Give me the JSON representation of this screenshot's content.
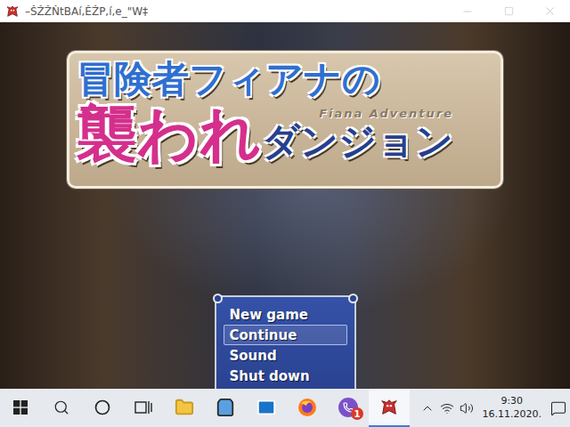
{
  "window": {
    "title": "–ŠŽŽŇtBAí,ĚŽP,í,e_\"W‡"
  },
  "logo": {
    "line1": "冒険者フィアナの",
    "line2_main": "襲われ",
    "line2_rest": "ダンジョン",
    "subtitle": "Fiana Adventure"
  },
  "menu": {
    "items": [
      {
        "label": "New game",
        "selected": false
      },
      {
        "label": "Continue",
        "selected": true
      },
      {
        "label": "Sound",
        "selected": false
      },
      {
        "label": "Shut down",
        "selected": false
      }
    ]
  },
  "taskbar": {
    "apps": [
      {
        "kind": "start",
        "active": false,
        "badge": ""
      },
      {
        "kind": "search",
        "active": false,
        "badge": ""
      },
      {
        "kind": "cortana",
        "active": false,
        "badge": ""
      },
      {
        "kind": "taskview",
        "active": false,
        "badge": ""
      },
      {
        "kind": "explorer",
        "active": false,
        "badge": ""
      },
      {
        "kind": "store",
        "active": false,
        "badge": ""
      },
      {
        "kind": "mail",
        "active": false,
        "badge": ""
      },
      {
        "kind": "firefox",
        "active": false,
        "badge": ""
      },
      {
        "kind": "viber",
        "active": false,
        "badge": "1"
      },
      {
        "kind": "game",
        "active": true,
        "badge": ""
      }
    ],
    "clock": {
      "time": "9:30",
      "date": "16.11.2020."
    }
  }
}
